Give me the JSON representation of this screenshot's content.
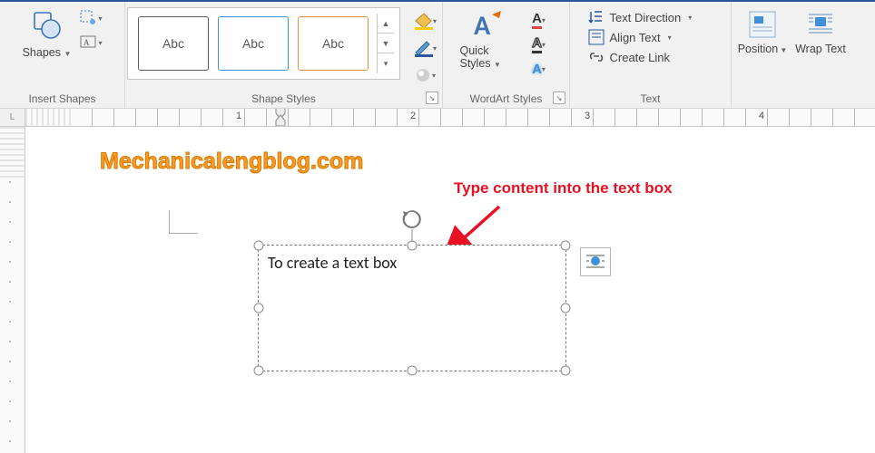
{
  "ribbon": {
    "insert_shapes": {
      "shapes_label": "Shapes",
      "group_label": "Insert Shapes"
    },
    "shape_styles": {
      "swatch_text": "Abc",
      "group_label": "Shape Styles"
    },
    "wordart_styles": {
      "quick_styles_label": "Quick Styles",
      "sample_letter": "A",
      "group_label": "WordArt Styles"
    },
    "text_group": {
      "text_direction": "Text Direction",
      "align_text": "Align Text",
      "create_link": "Create Link",
      "group_label": "Text"
    },
    "arrange": {
      "position_label": "Position",
      "wrap_text_label": "Wrap Text"
    }
  },
  "ruler": {
    "corner": "L",
    "marks": [
      "1",
      "2",
      "3",
      "4"
    ]
  },
  "page": {
    "watermark": "Mechanicalengblog.com",
    "annotation": "Type content into the text box",
    "textbox_content": "To create a text box"
  }
}
